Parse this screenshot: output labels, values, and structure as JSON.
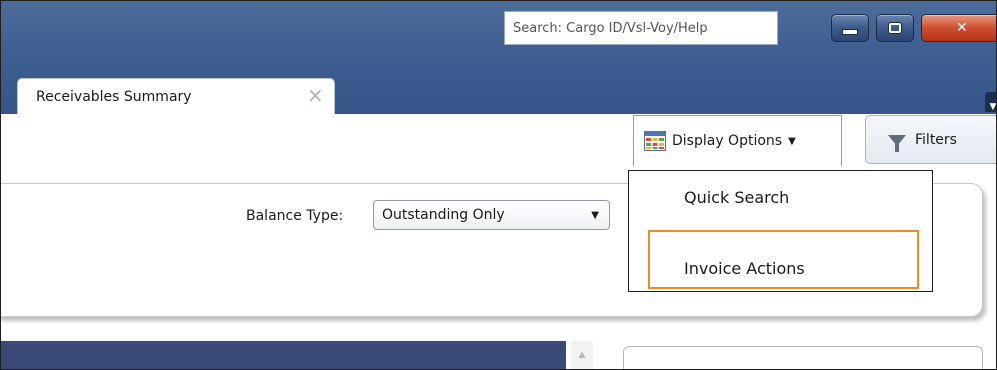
{
  "header": {
    "search": {
      "placeholder": "Search: Cargo ID/Vsl-Voy/Help",
      "value": ""
    }
  },
  "window_controls": {
    "minimize_icon": "minimize-icon",
    "restore_icon": "restore-icon",
    "close_icon": "close-icon",
    "close_color": "#cf4d2f"
  },
  "tabs": [
    {
      "label": "Receivables Summary",
      "active": true
    }
  ],
  "toolbar": {
    "display_options_label": "Display Options",
    "filters_label": "Filters"
  },
  "filters_panel": {
    "balance_type_label": "Balance Type:",
    "balance_type_value": "Outstanding Only"
  },
  "display_options_menu": {
    "items": [
      {
        "label": "Quick Search",
        "highlighted": false
      },
      {
        "label": "Invoice Actions",
        "highlighted": true
      }
    ],
    "highlight_color": "#f28a24"
  },
  "colors": {
    "titlebar": "#3f5f91",
    "grid_header": "#3a4975"
  }
}
